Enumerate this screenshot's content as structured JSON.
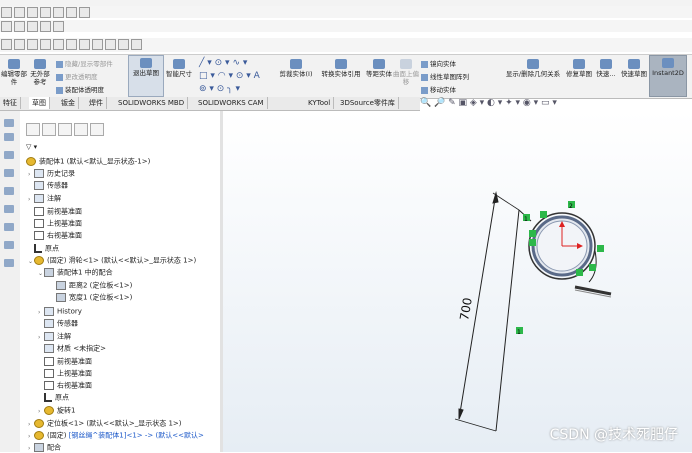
{
  "ribbon": {
    "edit_part": "编辑零部件",
    "no_external_ref": "无外部参考",
    "show_hide_parts": "隐藏/显示零部件",
    "change_transparency": "更改透明度",
    "assembly_transparency": "装配体透明度",
    "exit_sketch": "退出草图",
    "smart_dimension": "智能尺寸",
    "trim_entities": "剪裁实体(I)",
    "convert_entities": "转换实体引用",
    "offset_entities": "等距实体",
    "offset_on_surface": "曲面上偏移",
    "mirror_entities": "镜向实体",
    "linear_pattern": "线性草图阵列",
    "move_entities": "移动实体",
    "display_delete_relations": "显示/删除几何关系",
    "repair_sketch": "修复草图",
    "quick_snaps": "快速...",
    "rapid_sketch": "快速草图",
    "instant2d": "Instant2D"
  },
  "tabs": [
    "特征",
    "草图",
    "钣金",
    "焊件",
    "SOLIDWORKS MBD",
    "SOLIDWORKS CAM",
    "KYTool",
    "3DSource零件库"
  ],
  "tree": {
    "root": "装配体1 (默认<默认_显示状态-1>)",
    "history": "历史记录",
    "sensors": "传感器",
    "annotations": "注解",
    "front_plane": "前视基准面",
    "top_plane": "上视基准面",
    "right_plane": "右视基准面",
    "origin": "原点",
    "pulley": "(固定) 滑轮<1> (默认<<默认>_显示状态 1>)",
    "mates_in": "装配体1 中的配合",
    "distance2": "距离2 (定位板<1>)",
    "width1": "宽度1 (定位板<1>)",
    "history2": "History",
    "sensors2": "传感器",
    "annotations2": "注解",
    "material": "材质 <未指定>",
    "front_plane2": "前视基准面",
    "top_plane2": "上视基准面",
    "right_plane2": "右视基准面",
    "origin2": "原点",
    "revolve1": "旋转1",
    "locator_plate": "定位板<1> (默认<<默认>_显示状态 1>)",
    "wire_rope_prefix": "(固定) ",
    "wire_rope_link": "[钢丝绳^装配体1]<1> -> (默认<<默认>",
    "mates": "配合"
  },
  "sketch": {
    "dimension": "700",
    "relation_markers": [
      "1",
      "1",
      "2",
      "1",
      "1"
    ]
  },
  "watermark": "CSDN @技术死肥仔"
}
